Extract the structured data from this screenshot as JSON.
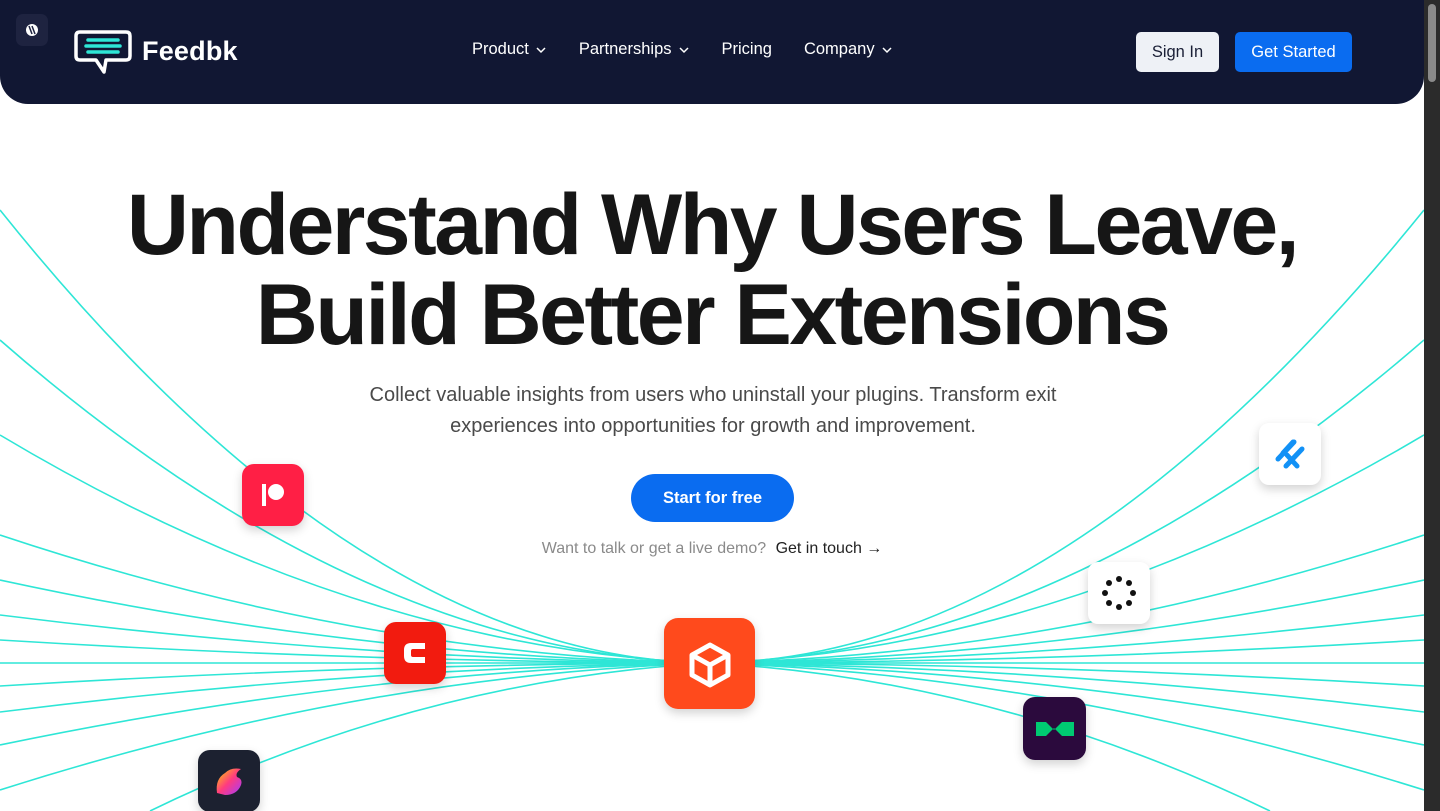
{
  "header": {
    "brand": "Feedbk",
    "nav": [
      {
        "label": "Product",
        "has_dropdown": true
      },
      {
        "label": "Partnerships",
        "has_dropdown": true
      },
      {
        "label": "Pricing",
        "has_dropdown": false
      },
      {
        "label": "Company",
        "has_dropdown": true
      }
    ],
    "sign_in_label": "Sign In",
    "get_started_label": "Get Started"
  },
  "hero": {
    "title_line1": "Understand Why Users Leave,",
    "title_line2": "Build Better Extensions",
    "subtitle": "Collect valuable insights from users who uninstall your plugins. Transform exit experiences into opportunities for growth and improvement.",
    "cta_label": "Start for free",
    "demo_prompt": "Want to talk or get a live demo?",
    "demo_link": "Get in touch →"
  },
  "icons": [
    "patreon-icon",
    "craft-icon",
    "roblox-studio-icon",
    "aws-box-icon",
    "loading-dots-icon",
    "helpscout-icon",
    "monday-icon"
  ],
  "colors": {
    "header_bg": "#111733",
    "accent_blue": "#0a6cf0",
    "line_teal": "#2ee6d6",
    "patreon_red": "#ff1f45",
    "craft_red": "#f21b0f",
    "box_orange": "#ff4a1c",
    "monday_purple": "#2b0a3d",
    "helpscout_blue": "#1291f6"
  }
}
